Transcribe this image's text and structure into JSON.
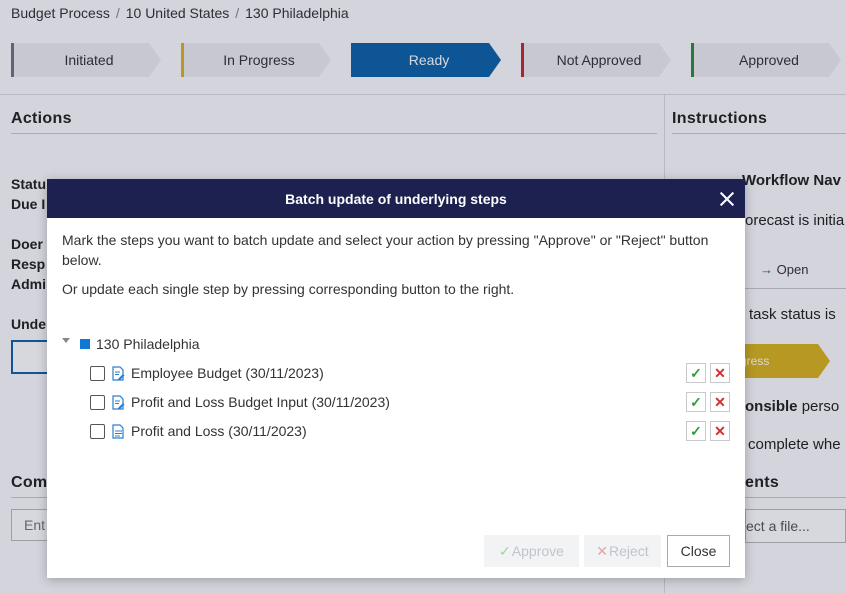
{
  "breadcrumb": [
    "Budget Process",
    "10 United States",
    "130 Philadelphia"
  ],
  "status_steps": [
    {
      "label": "Initiated",
      "color": "#6f7382",
      "active": false
    },
    {
      "label": "In Progress",
      "color": "#d8b21f",
      "active": false
    },
    {
      "label": "Ready",
      "color": "#0d62a8",
      "active": true
    },
    {
      "label": "Not Approved",
      "color": "#c62828",
      "active": false
    },
    {
      "label": "Approved",
      "color": "#2e8b3a",
      "active": false
    }
  ],
  "actions": {
    "heading": "Actions",
    "status_label": "Statu",
    "due_label": "Due I",
    "doer_label": "Doer",
    "resp_label": "Resp",
    "admin_label": "Admi",
    "under_label": "Unde",
    "comments_label": "Com",
    "comment_placeholder": "Ent"
  },
  "instructions": {
    "heading": "Instructions",
    "workflow_heading": "Workflow Nav",
    "forecast_text": "orecast is initia",
    "open_label": "Open",
    "task_status_text": "task status is",
    "chevron_text": "gress",
    "responsible_text": "onsible",
    "person_text": "perso",
    "complete_text": "complete whe",
    "attachments_label": "ents",
    "select_file": "ect a file..."
  },
  "dialog": {
    "title": "Batch update of underlying steps",
    "instruction": "Mark the steps you want to batch update and select your action by pressing \"Approve\" or \"Reject\" button below.",
    "instruction2": "Or update each single step by pressing corresponding button to the right.",
    "root_label": "130 Philadelphia",
    "steps": [
      {
        "label": "Employee Budget (30/11/2023)",
        "icon": "edit-document-icon"
      },
      {
        "label": "Profit and Loss Budget Input (30/11/2023)",
        "icon": "edit-document-icon"
      },
      {
        "label": "Profit and Loss (30/11/2023)",
        "icon": "document-icon"
      }
    ],
    "approve_label": "Approve",
    "reject_label": "Reject",
    "close_label": "Close"
  },
  "colors": {
    "header_bg": "#1c2150",
    "accent": "#0d62a8",
    "approve": "#2e9e38",
    "reject": "#d32f2f"
  }
}
